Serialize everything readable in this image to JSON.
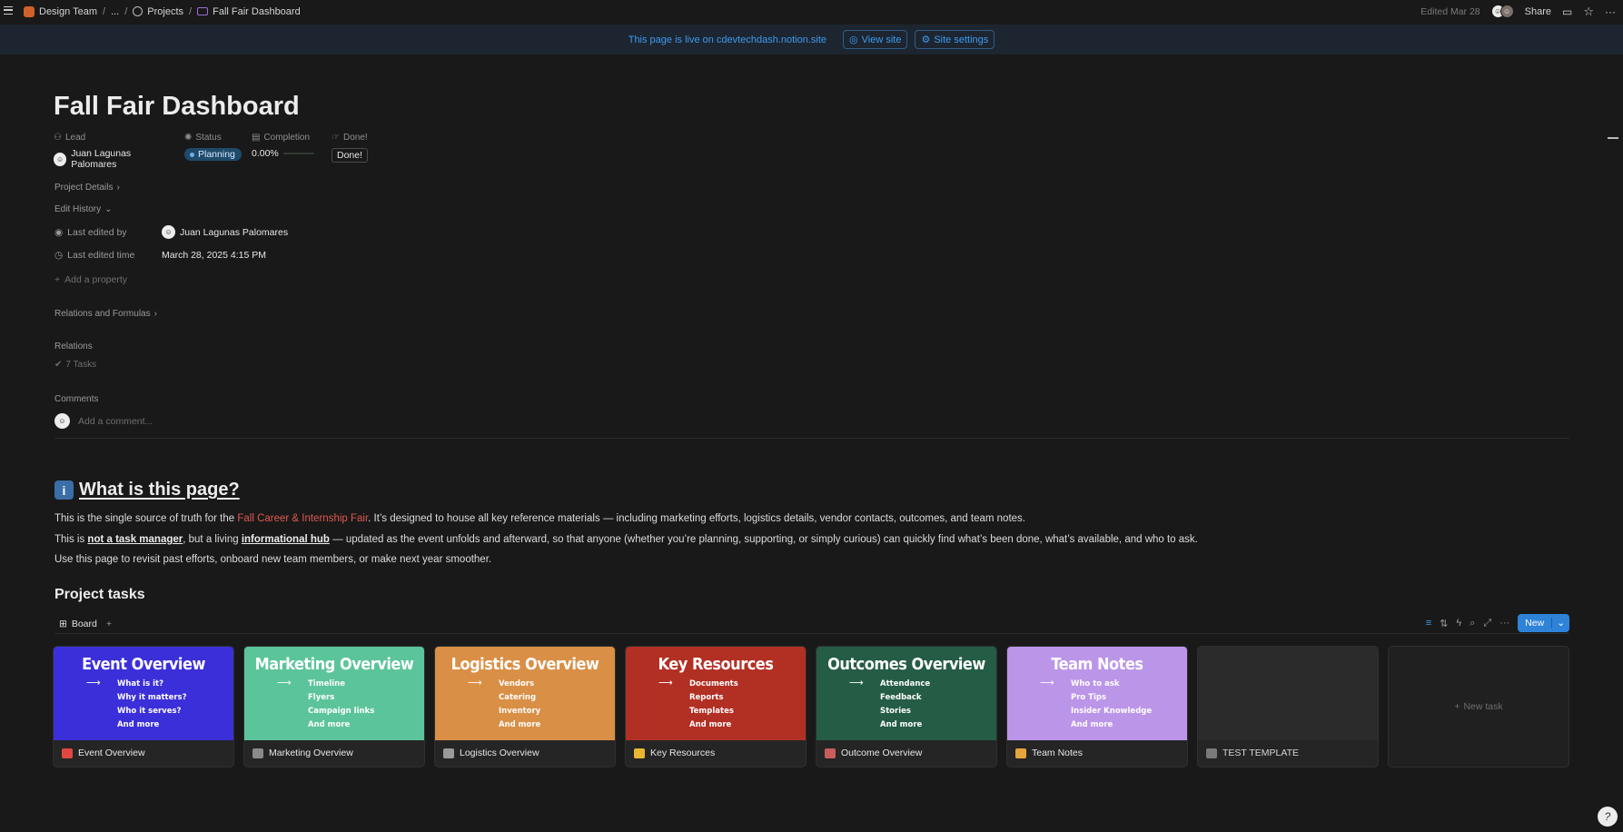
{
  "breadcrumb": {
    "workspace": "Design Team",
    "ellipsis": "...",
    "projects": "Projects",
    "current": "Fall Fair Dashboard"
  },
  "topbar": {
    "edited": "Edited Mar 28",
    "share": "Share"
  },
  "banner": {
    "message": "This page is live on cdevtechdash.notion.site",
    "view_site": "View site",
    "site_settings": "Site settings"
  },
  "page": {
    "title": "Fall Fair Dashboard"
  },
  "properties": {
    "lead_label": "Lead",
    "lead_value": "Juan Lagunas Palomares",
    "status_label": "Status",
    "status_value": "Planning",
    "completion_label": "Completion",
    "completion_value": "0.00%",
    "completion_fraction": 0,
    "done_label": "Done!",
    "done_button": "Done!"
  },
  "sections": {
    "project_details": "Project Details",
    "edit_history": "Edit History",
    "last_edited_by_label": "Last edited by",
    "last_edited_by_value": "Juan Lagunas Palomares",
    "last_edited_time_label": "Last edited time",
    "last_edited_time_value": "March 28, 2025 4:15 PM",
    "add_property": "Add a property",
    "relations_formulas": "Relations and Formulas",
    "relations": "Relations",
    "tasks_count": "7 Tasks",
    "comments": "Comments",
    "comment_placeholder": "Add a comment..."
  },
  "about": {
    "heading": "What is this page?",
    "p1_a": "This is the single source of truth for the ",
    "p1_link": "Fall Career & Internship Fair",
    "p1_b": ". It’s designed to house all key reference materials — including marketing efforts, logistics details, vendor contacts, outcomes, and team notes.",
    "p2_a": "This is ",
    "p2_b1": "not a task manager",
    "p2_c": ", but a living ",
    "p2_b2": "informational hub",
    "p2_d": " — updated as the event unfolds and afterward, so that anyone (whether you’re planning, supporting, or simply curious) can quickly find what’s been done, what’s available, and who to ask.",
    "p3": "Use this page to revisit past efforts, onboard new team members, or make next year smoother."
  },
  "tasks": {
    "heading": "Project tasks",
    "view_tab": "Board",
    "new_button": "New",
    "new_task": "New task",
    "cards": [
      {
        "cover_title": "Event Overview",
        "cover_items": [
          "What is it?",
          "Why it matters?",
          "Who it serves?",
          "And more"
        ],
        "cover_color": "#3b2fd9",
        "name": "Event Overview",
        "emoji_color": "#e0483f"
      },
      {
        "cover_title": "Marketing Overview",
        "cover_items": [
          "Timeline",
          "Flyers",
          "Campaign links",
          "And more"
        ],
        "cover_color": "#5cc49b",
        "name": "Marketing Overview",
        "emoji_color": "#8a8a8a"
      },
      {
        "cover_title": "Logistics Overview",
        "cover_items": [
          "Vendors",
          "Catering",
          "Inventory",
          "And more"
        ],
        "cover_color": "#d98f45",
        "name": "Logistics Overview",
        "emoji_color": "#9a9a9a"
      },
      {
        "cover_title": "Key Resources",
        "cover_items": [
          "Documents",
          "Reports",
          "Templates",
          "And more"
        ],
        "cover_color": "#b22f24",
        "name": "Key Resources",
        "emoji_color": "#e8b632"
      },
      {
        "cover_title": "Outcomes Overview",
        "cover_items": [
          "Attendance",
          "Feedback",
          "Stories",
          "And more"
        ],
        "cover_color": "#245c45",
        "name": "Outcome Overview",
        "emoji_color": "#c85d5d"
      },
      {
        "cover_title": "Team Notes",
        "cover_items": [
          "Who to ask",
          "Pro Tips",
          "Insider Knowledge",
          "And more"
        ],
        "cover_color": "#bb95e8",
        "name": "Team Notes",
        "emoji_color": "#e6a43c"
      },
      {
        "cover_title": "",
        "cover_items": [],
        "cover_color": "#2b2b2b",
        "name": "TEST TEMPLATE",
        "emoji_color": "#7a7a7a"
      }
    ]
  },
  "colors": {
    "background": "#191919",
    "accent": "#2e83d9",
    "banner_bg": "#1d2530",
    "link_red": "#e0584f"
  }
}
